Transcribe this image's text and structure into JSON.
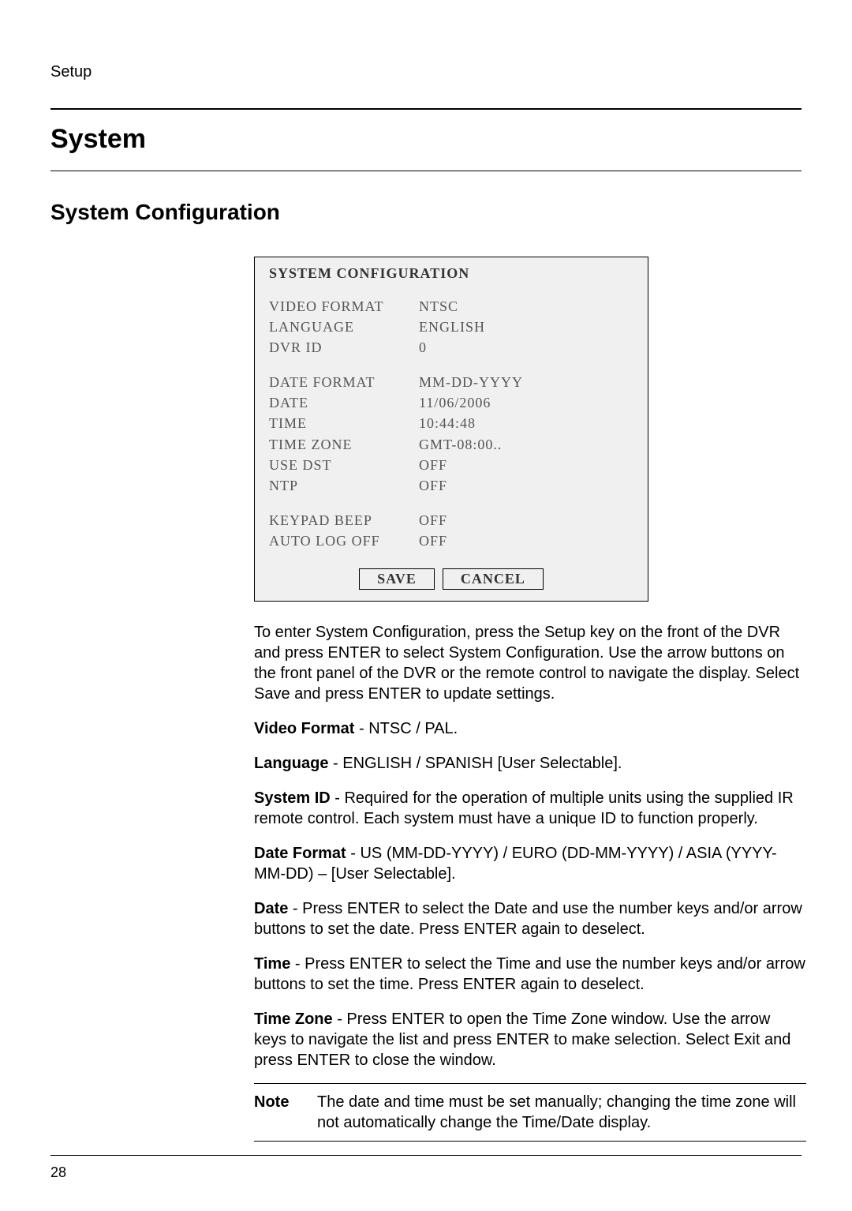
{
  "header": {
    "section": "Setup"
  },
  "title": "System",
  "subtitle": "System Configuration",
  "configBox": {
    "title": "SYSTEM CONFIGURATION",
    "group1": [
      {
        "label": "VIDEO FORMAT",
        "value": "NTSC"
      },
      {
        "label": "LANGUAGE",
        "value": "ENGLISH"
      },
      {
        "label": "DVR ID",
        "value": "0"
      }
    ],
    "group2": [
      {
        "label": "DATE FORMAT",
        "value": "MM-DD-YYYY"
      },
      {
        "label": "DATE",
        "value": "11/06/2006"
      },
      {
        "label": "TIME",
        "value": "10:44:48"
      },
      {
        "label": "TIME ZONE",
        "value": "GMT-08:00.."
      },
      {
        "label": "USE DST",
        "value": "OFF"
      },
      {
        "label": "NTP",
        "value": "OFF"
      }
    ],
    "group3": [
      {
        "label": "KEYPAD BEEP",
        "value": "OFF"
      },
      {
        "label": "AUTO LOG OFF",
        "value": "OFF"
      }
    ],
    "buttons": {
      "save": "SAVE",
      "cancel": "CANCEL"
    }
  },
  "body": {
    "intro": "To enter System Configuration, press the Setup key on the front of the DVR and press ENTER to select System Configuration. Use the arrow buttons on the front panel of the DVR or the remote control to navigate the display. Select Save and press ENTER to update settings.",
    "items": [
      {
        "bold": "Video Format",
        "text": " - NTSC / PAL."
      },
      {
        "bold": "Language",
        "text": " - ENGLISH / SPANISH [User Selectable]."
      },
      {
        "bold": "System ID",
        "text": " - Required for the operation of multiple units using the supplied IR remote control. Each system must have a unique ID to function properly."
      },
      {
        "bold": "Date Format",
        "text": " - US (MM-DD-YYYY) / EURO (DD-MM-YYYY) / ASIA (YYYY-MM-DD) – [User Selectable]."
      },
      {
        "bold": "Date",
        "text": " - Press ENTER to select the Date and use the number keys and/or arrow buttons to set the date. Press ENTER again to deselect."
      },
      {
        "bold": "Time",
        "text": " - Press ENTER to select the Time and use the number keys and/or arrow buttons to set the time. Press ENTER again to deselect."
      },
      {
        "bold": "Time Zone",
        "text": " - Press ENTER to open the Time Zone window. Use the arrow keys to navigate the list and press ENTER to make selection. Select Exit and press ENTER to close the window."
      }
    ],
    "note": {
      "label": "Note",
      "text": "The date and time must be set manually; changing the time zone will not automatically change the Time/Date display."
    }
  },
  "pageNumber": "28"
}
